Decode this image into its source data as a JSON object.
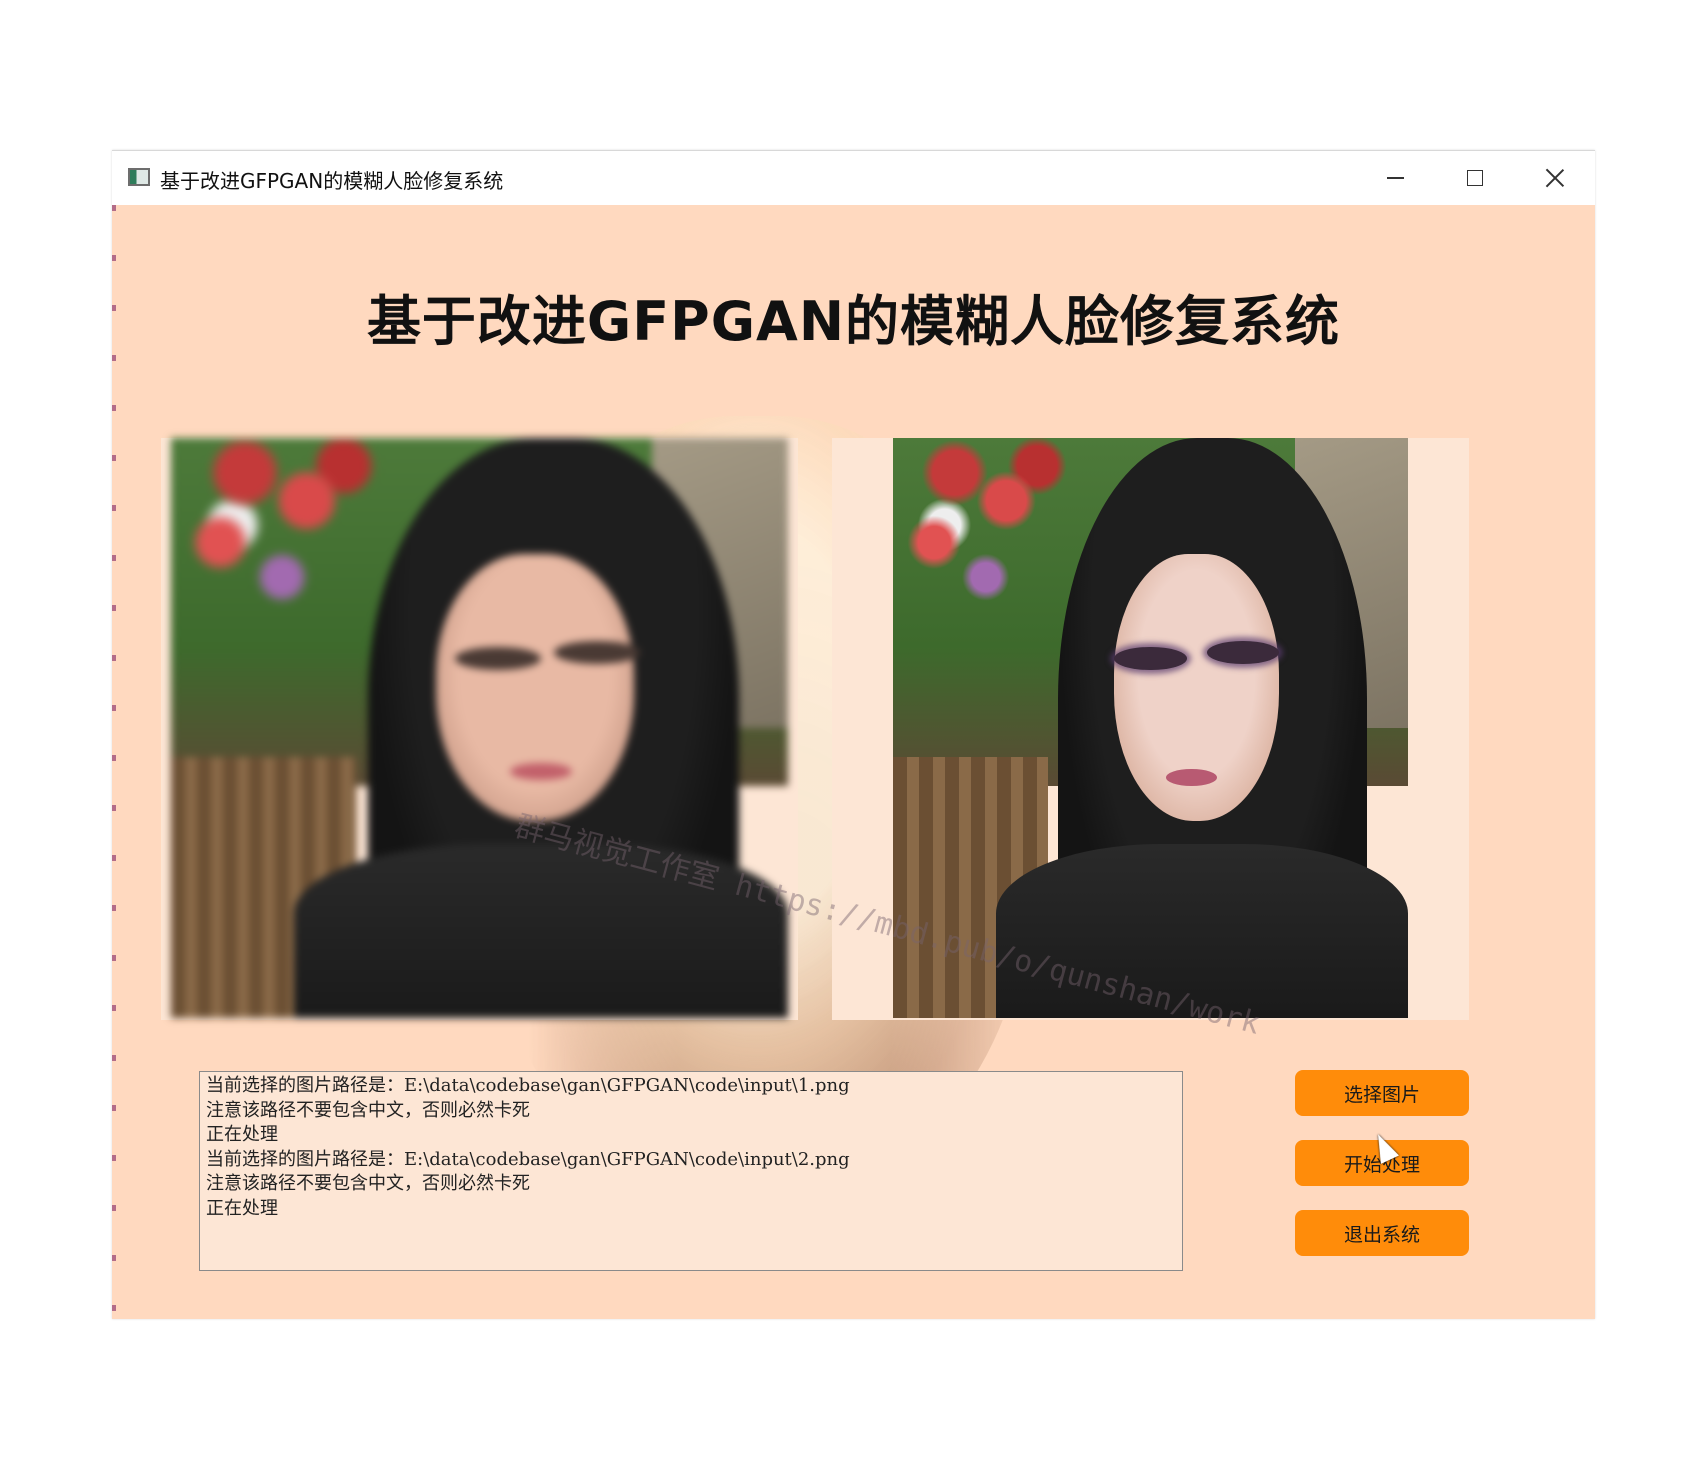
{
  "window": {
    "title": "基于改进GFPGAN的模糊人脸修复系统",
    "icons": {
      "app": "app-window-icon",
      "minimize": "minimize-icon",
      "maximize": "maximize-icon",
      "close": "close-icon"
    }
  },
  "main": {
    "heading": "基于改进GFPGAN的模糊人脸修复系统",
    "watermark": "群马视觉工作室 https://mbd.pub/o/qunshan/work"
  },
  "images": {
    "input": "blurred-face-photo",
    "output": "restored-face-photo"
  },
  "log": {
    "lines": [
      "当前选择的图片路径是：E:\\data\\codebase\\gan\\GFPGAN\\code\\input\\1.png",
      "注意该路径不要包含中文，否则必然卡死",
      "正在处理",
      "当前选择的图片路径是：E:\\data\\codebase\\gan\\GFPGAN\\code\\input\\2.png",
      "注意该路径不要包含中文，否则必然卡死",
      "正在处理"
    ]
  },
  "buttons": {
    "select": "选择图片",
    "start": "开始处理",
    "exit": "退出系统"
  },
  "colors": {
    "background": "#ffd9bf",
    "button": "#ff8c0a",
    "panel": "#fde6d5"
  }
}
